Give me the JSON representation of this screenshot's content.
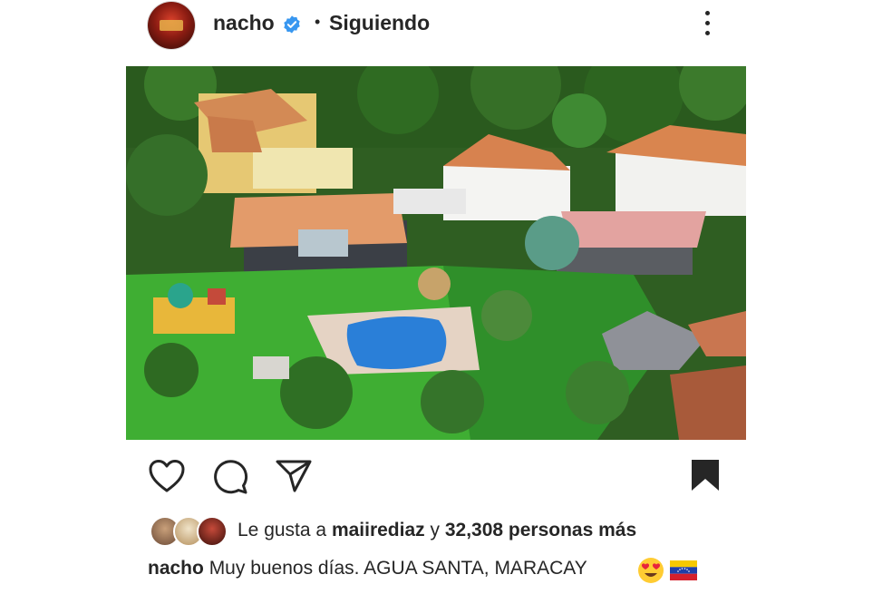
{
  "post": {
    "username": "nacho",
    "separator": "•",
    "follow_status": "Siguiendo",
    "likes": {
      "prefix": "Le gusta a",
      "first_liker": "maiirediaz",
      "conjunction": "y",
      "others": "32,308 personas más"
    },
    "caption": {
      "author": "nacho",
      "text": "Muy buenos días. AGUA SANTA, MARACAY"
    }
  },
  "icons": {
    "verified": "verified-badge-icon",
    "more": "more-options-icon",
    "like": "heart-icon",
    "comment": "comment-icon",
    "share": "paper-plane-icon",
    "save": "bookmark-icon",
    "emoji_1": "heart-eyes-emoji-icon",
    "emoji_2": "venezuela-flag-icon"
  },
  "colors": {
    "verified_blue": "#3897f0",
    "text": "#262626"
  }
}
